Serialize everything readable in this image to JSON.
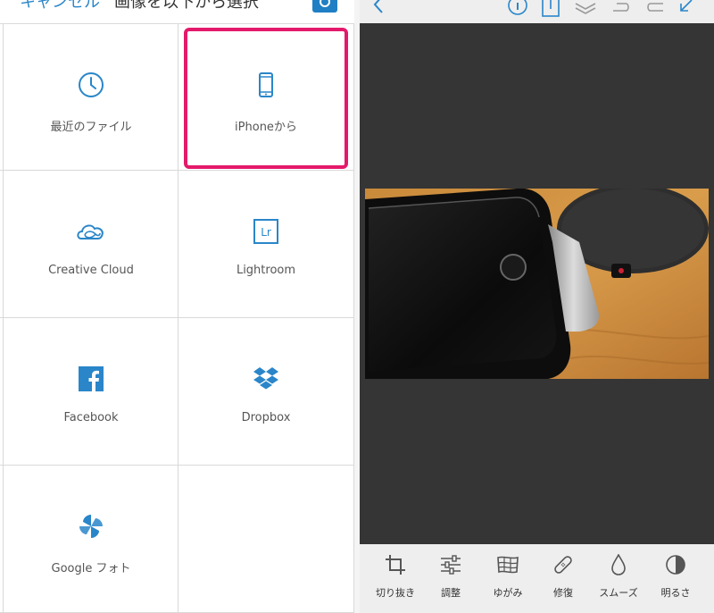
{
  "left_panel": {
    "cancel_label": "キャンセル",
    "title": "画像を以下から選択",
    "tiles": [
      {
        "label": "最近のファイル",
        "icon": "clock-icon"
      },
      {
        "label": "iPhoneから",
        "icon": "phone-icon"
      },
      {
        "label": "Creative Cloud",
        "icon": "creative-cloud-icon"
      },
      {
        "label": "Lightroom",
        "icon": "lightroom-icon"
      },
      {
        "label": "Facebook",
        "icon": "facebook-icon"
      },
      {
        "label": "Dropbox",
        "icon": "dropbox-icon"
      },
      {
        "label": "Google フォト",
        "icon": "google-photos-icon"
      }
    ],
    "accent_color": "#2a86c9",
    "highlight_color": "#e4196b"
  },
  "right_panel": {
    "toolbar_icons": [
      "back-icon",
      "info-icon",
      "export-icon",
      "layers-icon",
      "undo-icon",
      "redo-icon",
      "collapse-icon"
    ],
    "tools": [
      {
        "label": "切り抜き",
        "icon": "crop-icon"
      },
      {
        "label": "調整",
        "icon": "sliders-icon"
      },
      {
        "label": "ゆがみ",
        "icon": "warp-grid-icon"
      },
      {
        "label": "修復",
        "icon": "bandage-icon"
      },
      {
        "label": "スムーズ",
        "icon": "drop-icon"
      },
      {
        "label": "明るさ",
        "icon": "brightness-icon"
      }
    ],
    "canvas_color": "#353535"
  }
}
